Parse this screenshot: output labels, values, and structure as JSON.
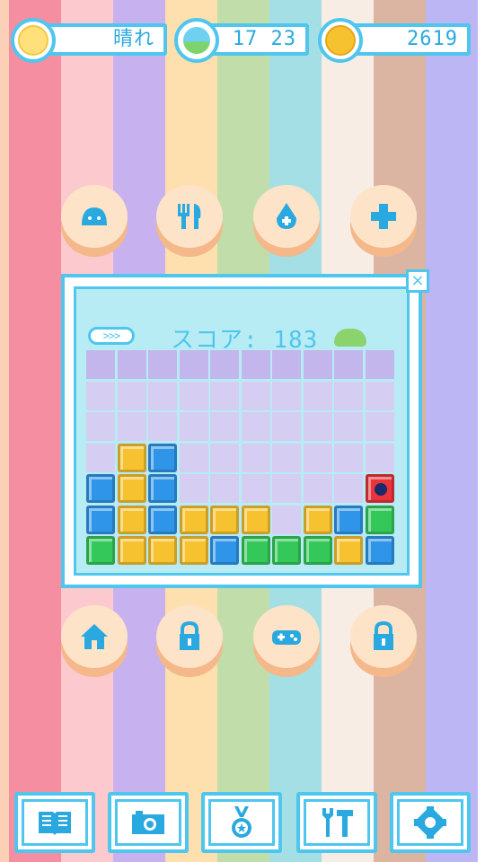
{
  "status": {
    "weather": {
      "icon": "sun-face-icon",
      "label": "晴れ"
    },
    "time": {
      "icon": "landscape-icon",
      "label": "17 23"
    },
    "coins": {
      "icon": "coin-icon",
      "label": "2619"
    }
  },
  "top_actions": [
    {
      "icon": "slime-icon"
    },
    {
      "icon": "fork-knife-icon"
    },
    {
      "icon": "water-drop-icon"
    },
    {
      "icon": "medical-cross-icon"
    }
  ],
  "game": {
    "score_label": "スコア: 183",
    "combo_label": ">>>",
    "close_label": "×",
    "columns": 10,
    "rows": 7,
    "colors": {
      "yellow": "#f7c230",
      "blue": "#2f95e8",
      "green": "#34c759",
      "red": "#e8343a",
      "bomb": "#1a2b6b"
    },
    "board": [
      [
        ".",
        ".",
        ".",
        ".",
        ".",
        ".",
        ".",
        ".",
        ".",
        "."
      ],
      [
        ".",
        ".",
        ".",
        ".",
        ".",
        ".",
        ".",
        ".",
        ".",
        "."
      ],
      [
        ".",
        ".",
        ".",
        ".",
        ".",
        ".",
        ".",
        ".",
        ".",
        "."
      ],
      [
        ".",
        "Y",
        "B",
        ".",
        ".",
        ".",
        ".",
        ".",
        ".",
        "."
      ],
      [
        "B",
        "Y",
        "B",
        ".",
        ".",
        ".",
        ".",
        ".",
        ".",
        "R"
      ],
      [
        "B",
        "Y",
        "B",
        "Y",
        "Y",
        "Y",
        ".",
        "Y",
        "B",
        "G"
      ],
      [
        "G",
        "Y",
        "Y",
        "Y",
        "B",
        "G",
        "G",
        "G",
        "Y",
        "B"
      ]
    ]
  },
  "mid_actions": [
    {
      "icon": "home-icon"
    },
    {
      "icon": "lock-icon"
    },
    {
      "icon": "gamepad-icon"
    },
    {
      "icon": "lock-icon"
    }
  ],
  "toolbar": [
    {
      "icon": "book-icon"
    },
    {
      "icon": "camera-icon"
    },
    {
      "icon": "medal-icon"
    },
    {
      "icon": "tools-icon"
    },
    {
      "icon": "settings-gear-icon"
    }
  ],
  "background_stripes": [
    "#f7a6a6",
    "#fbc4c9",
    "#c5b1ee",
    "#fde0b0",
    "#bfe2ad",
    "#a7e0e6",
    "#f6eee6",
    "#dcb7a4",
    "#bcb6f3"
  ],
  "accent": "#4fc6ee"
}
